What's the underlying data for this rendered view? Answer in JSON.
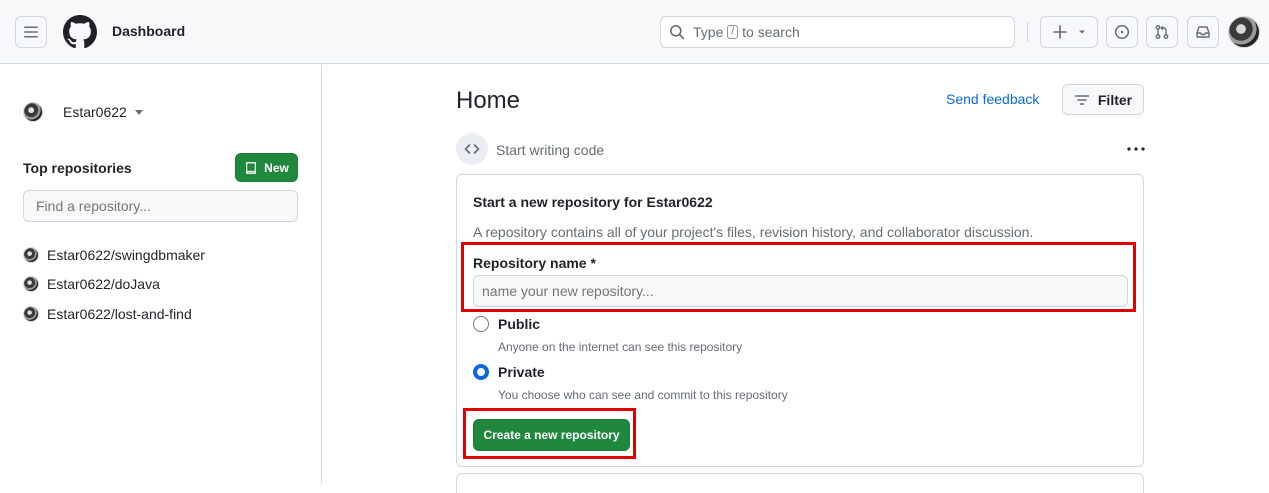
{
  "header": {
    "context_title": "Dashboard",
    "search_placeholder_pre": "Type",
    "search_key": "/",
    "search_placeholder_post": "to search"
  },
  "sidebar": {
    "account_name": "Estar0622",
    "top_repos_label": "Top repositories",
    "new_button": "New",
    "find_placeholder": "Find a repository...",
    "repos": [
      {
        "name": "Estar0622/swingdbmaker"
      },
      {
        "name": "Estar0622/doJava"
      },
      {
        "name": "Estar0622/lost-and-find"
      }
    ]
  },
  "main": {
    "title": "Home",
    "send_feedback": "Send feedback",
    "filter_label": "Filter",
    "start_writing": "Start writing code",
    "card": {
      "title": "Start a new repository for Estar0622",
      "description": "A repository contains all of your project's files, revision history, and collaborator discussion.",
      "name_label": "Repository name *",
      "name_placeholder": "name your new repository...",
      "public_label": "Public",
      "public_help": "Anyone on the internet can see this repository",
      "private_label": "Private",
      "private_help": "You choose who can see and commit to this repository",
      "visibility_selected": "Private",
      "create_button": "Create a new repository"
    }
  },
  "colors": {
    "primary_green": "#1f883d",
    "link_blue": "#0969da",
    "highlight_red": "#e00000"
  }
}
